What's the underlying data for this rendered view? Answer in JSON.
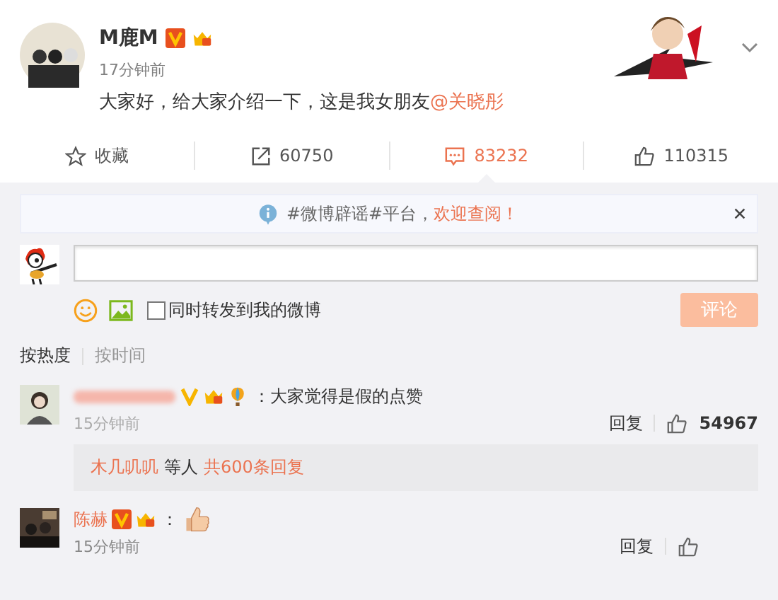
{
  "post": {
    "author": "M鹿M",
    "badges": [
      {
        "kind": "verified-v"
      },
      {
        "kind": "crown"
      }
    ],
    "time": "17分钟前",
    "text": "大家好，给大家介绍一下，这是我女朋友",
    "mention": "@关晓彤"
  },
  "actions": [
    {
      "kind": "favorite",
      "label": "收藏",
      "selected": false
    },
    {
      "kind": "repost",
      "label": "60750",
      "selected": false
    },
    {
      "kind": "comment",
      "label": "83232",
      "selected": true
    },
    {
      "kind": "like",
      "label": "110315",
      "selected": false
    }
  ],
  "notice": {
    "text": "#微博辟谣#平台，",
    "link": "欢迎查阅！"
  },
  "composer": {
    "repost_label": "同时转发到我的微博",
    "repost_checked": false,
    "submit": "评论",
    "submit_disabled": true
  },
  "sort_tabs": [
    {
      "label": "按热度",
      "selected": true
    },
    {
      "label": "按时间",
      "selected": false
    }
  ],
  "comments": [
    {
      "name_blurred": true,
      "badges": [
        {
          "kind": "verified-v"
        },
        {
          "kind": "crown"
        },
        {
          "kind": "balloon"
        }
      ],
      "text": "：大家觉得是假的点赞",
      "emoji": false,
      "time": "15分钟前",
      "reply": "回复",
      "likes": "54967",
      "replies": {
        "names": "木几叽叽",
        "middle": "等人",
        "total": "共600条回复"
      }
    },
    {
      "name": "陈赫",
      "name_blurred": false,
      "badges": [
        {
          "kind": "verified-box"
        },
        {
          "kind": "crown"
        }
      ],
      "text": "：",
      "emoji": true,
      "time": "15分钟前",
      "reply": "回复"
    }
  ]
}
